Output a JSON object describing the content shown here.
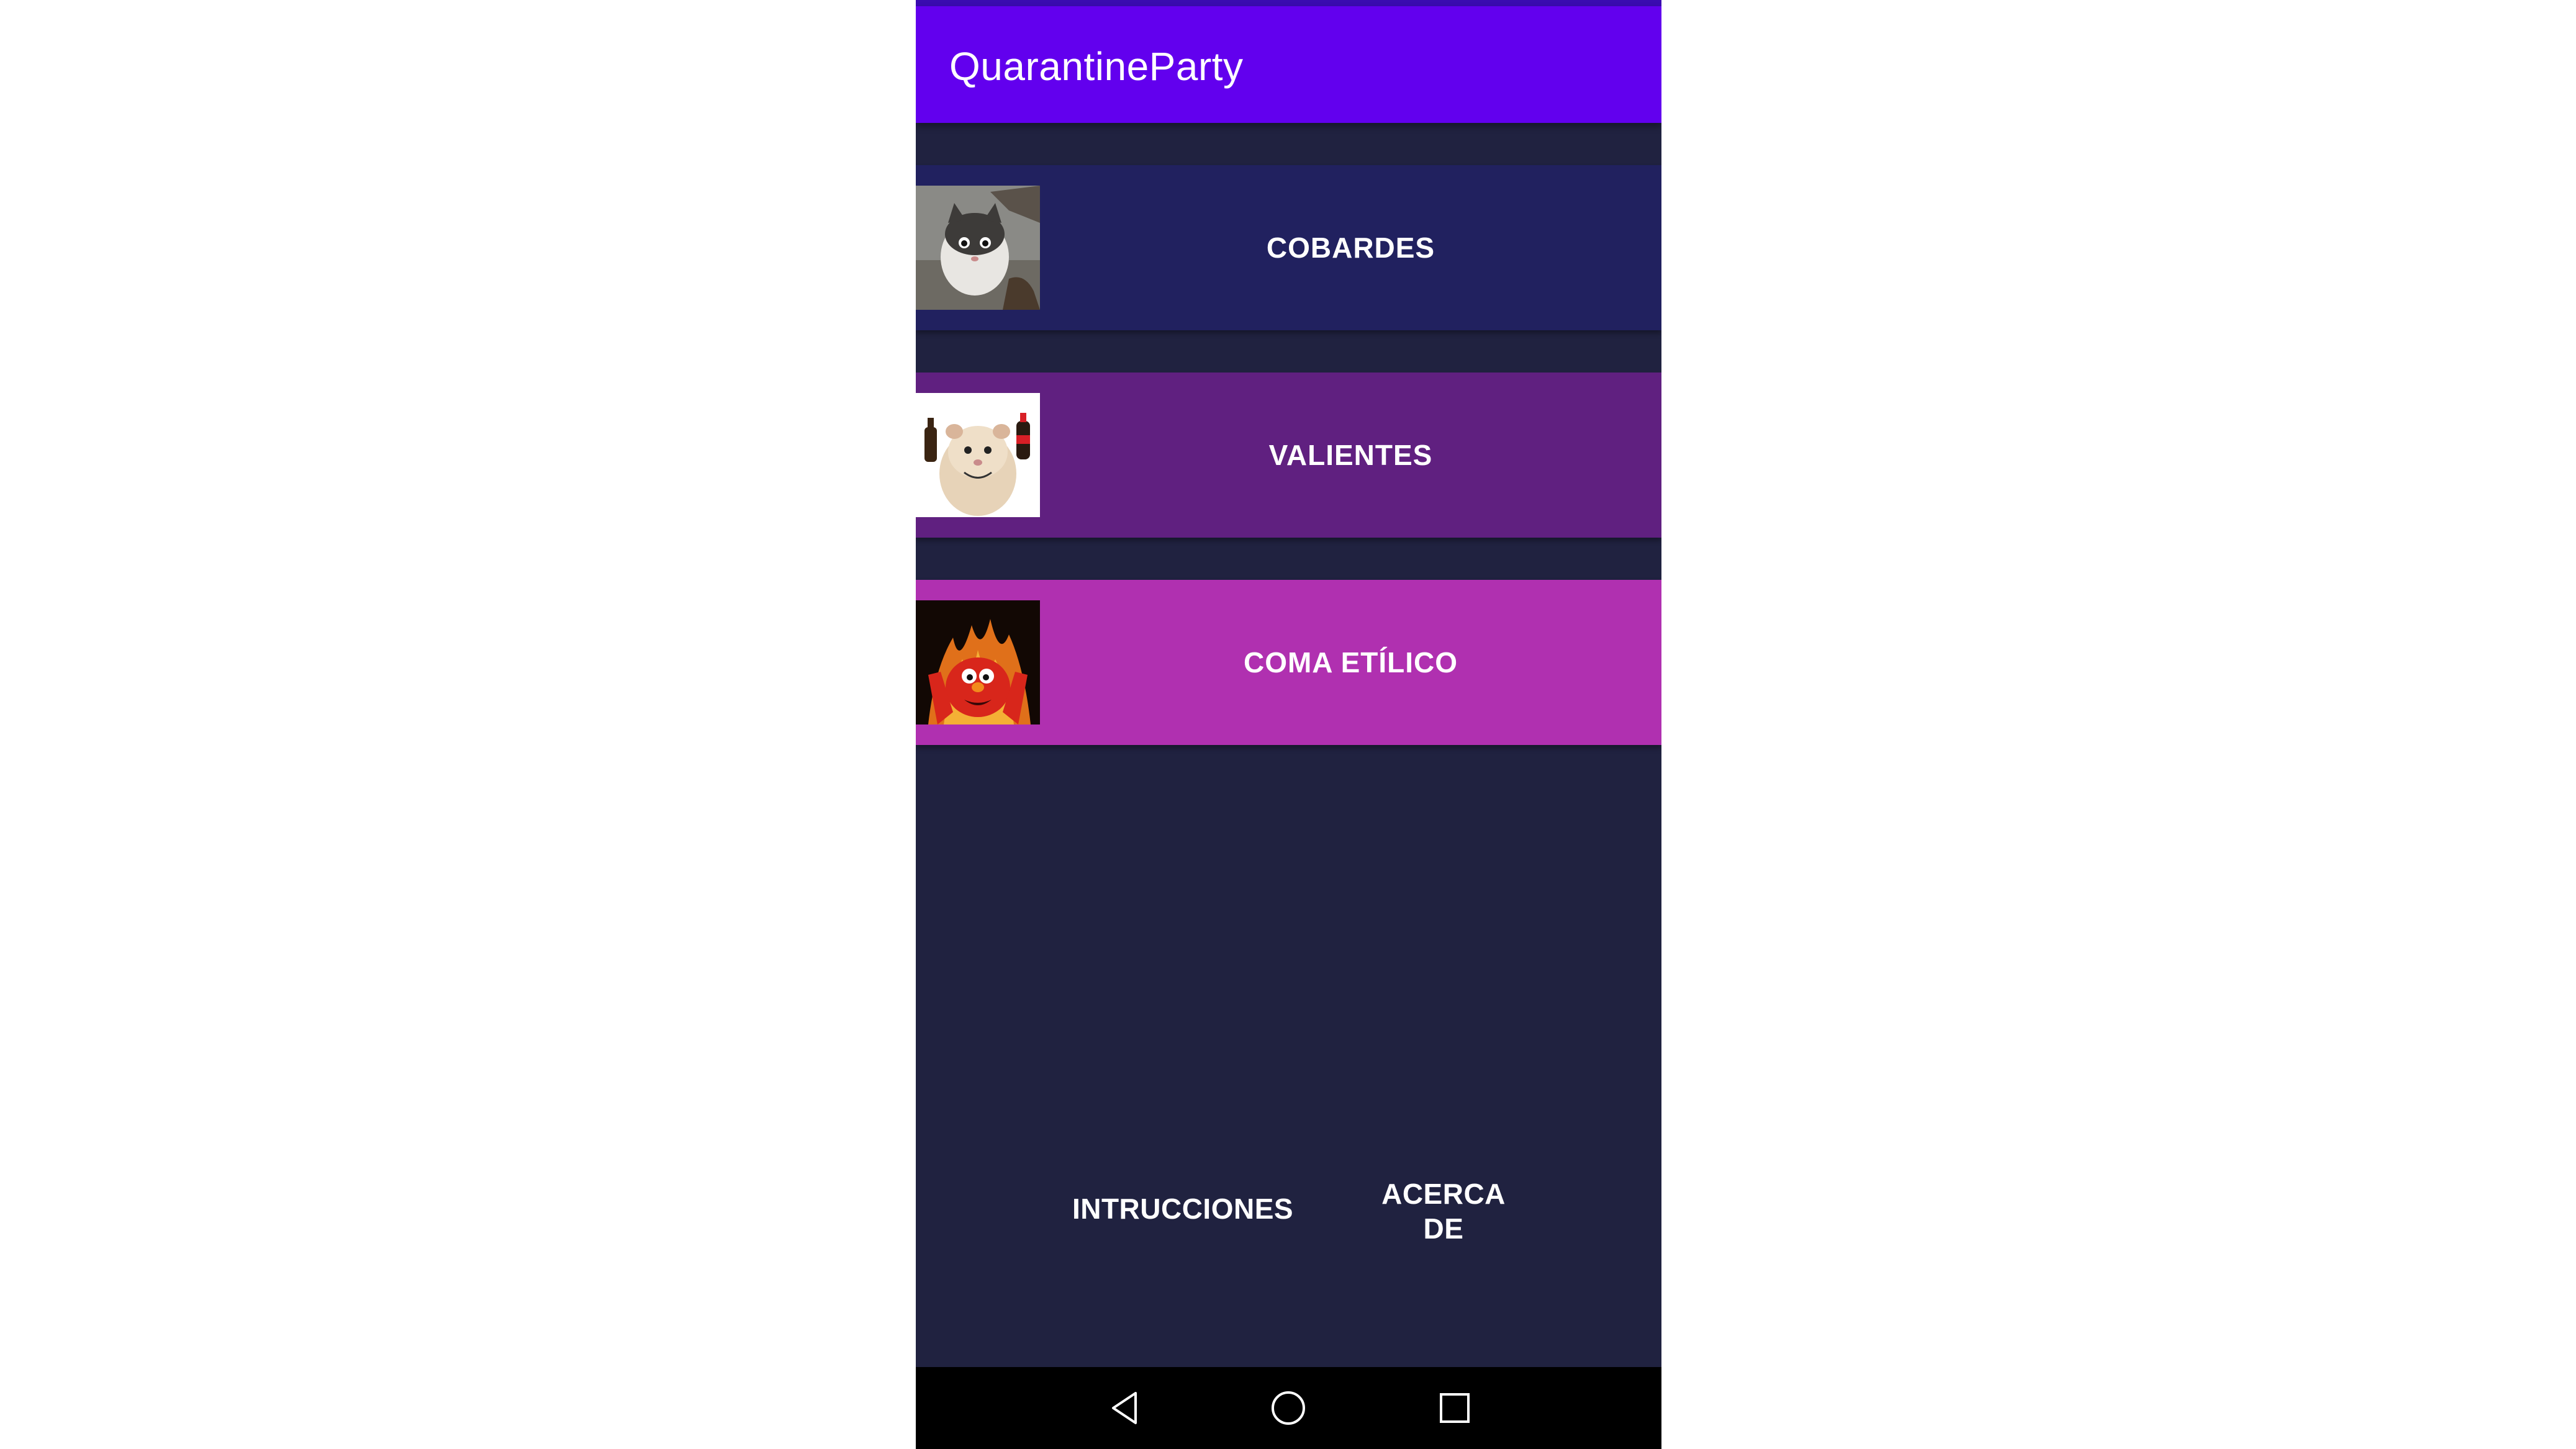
{
  "app": {
    "title": "QuarantineParty"
  },
  "levels": [
    {
      "label": "COBARDES",
      "image": "scared-cat-image",
      "color": "#21215f"
    },
    {
      "label": "VALIENTES",
      "image": "hamster-with-bottles-image",
      "color": "#602080"
    },
    {
      "label": "COMA ETÍLICO",
      "image": "elmo-on-fire-image",
      "color": "#b030b0"
    }
  ],
  "bottom": {
    "instructions_label": "INTRUCCIONES",
    "about_line1": "ACERCA",
    "about_line2": "DE"
  },
  "nav": {
    "icons": [
      "back-triangle-icon",
      "home-circle-icon",
      "recents-square-icon"
    ]
  },
  "colors": {
    "app_bar": "#6200ee",
    "background": "#202240",
    "nav_bar": "#000000"
  }
}
